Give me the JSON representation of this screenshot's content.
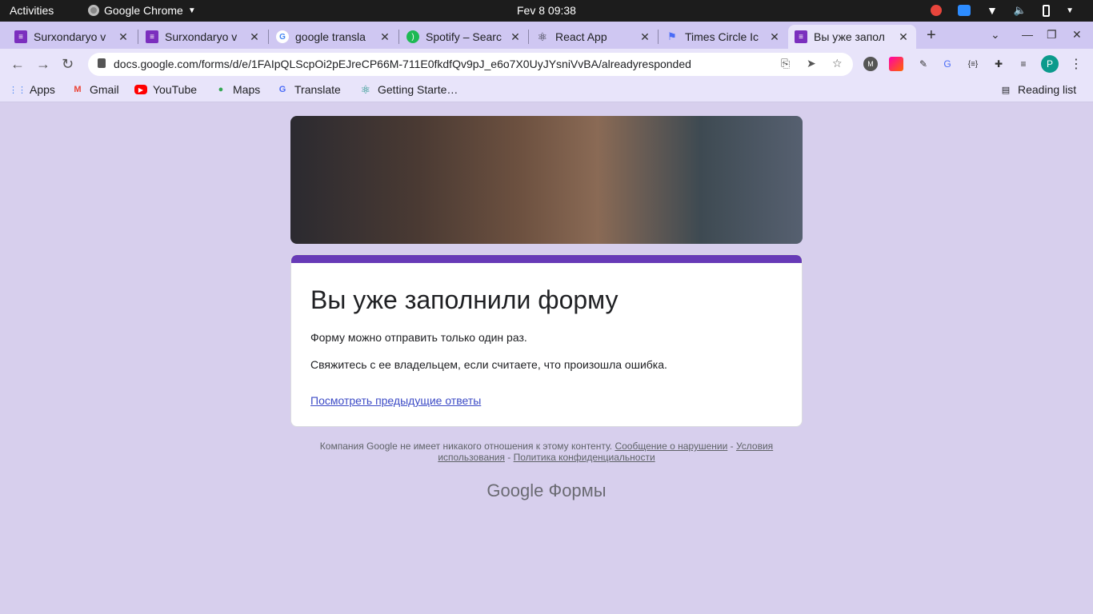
{
  "os": {
    "activities": "Activities",
    "app_name": "Google Chrome",
    "clock": "Fev 8  09:38"
  },
  "tabs": [
    {
      "title": "Surxondaryo v",
      "icon": "google-forms-icon",
      "color": "#7b2fbe"
    },
    {
      "title": "Surxondaryo v",
      "icon": "google-forms-icon",
      "color": "#7b2fbe"
    },
    {
      "title": "google transla",
      "icon": "google-g-icon",
      "color": "#4285f4"
    },
    {
      "title": "Spotify – Searc",
      "icon": "spotify-icon",
      "color": "#1db954"
    },
    {
      "title": "React App",
      "icon": "react-icon",
      "color": "#20232a"
    },
    {
      "title": "Times Circle Ic",
      "icon": "flag-icon",
      "color": "#4a6cf7"
    },
    {
      "title": "Вы уже запол",
      "icon": "google-forms-icon",
      "color": "#7b2fbe"
    }
  ],
  "address_bar": {
    "url": "docs.google.com/forms/d/e/1FAIpQLScpOi2pEJreCP66M-711E0fkdfQv9pJ_e6o7X0UyJYsniVvBA/alreadyresponded"
  },
  "profile_initial": "P",
  "bookmarks": [
    {
      "label": "Apps",
      "icon": "apps-grid-icon"
    },
    {
      "label": "Gmail",
      "icon": "gmail-icon"
    },
    {
      "label": "YouTube",
      "icon": "youtube-icon"
    },
    {
      "label": "Maps",
      "icon": "maps-pin-icon"
    },
    {
      "label": "Translate",
      "icon": "translate-icon"
    },
    {
      "label": "Getting Starte…",
      "icon": "react-icon"
    }
  ],
  "reading_list": "Reading list",
  "form": {
    "title": "Вы уже заполнили форму",
    "line1": "Форму можно отправить только один раз.",
    "line2": "Свяжитесь с ее владельцем, если считаете, что произошла ошибка.",
    "link": "Посмотреть предыдущие ответы",
    "accent_color": "#673ab7"
  },
  "footer": {
    "text": "Компания Google не имеет никакого отношения к этому контенту.",
    "report": "Сообщение о нарушении",
    "sep1": " - ",
    "terms": "Условия использования",
    "sep2": " - ",
    "privacy": "Политика конфиденциальности"
  },
  "brand": {
    "google": "Google",
    "forms": "Формы"
  }
}
